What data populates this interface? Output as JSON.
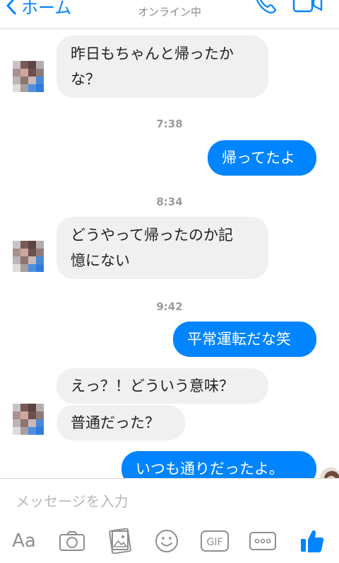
{
  "header": {
    "back_label": "ホーム",
    "status": "オンライン中",
    "icons": [
      "chevron-left-icon",
      "phone-icon",
      "video-camera-icon"
    ]
  },
  "messages": [
    {
      "type": "received",
      "lines": [
        "昨日もちゃんと帰ったか",
        "な？"
      ]
    },
    {
      "type": "time",
      "text": "7:38"
    },
    {
      "type": "sent",
      "text": "帰ってたよ"
    },
    {
      "type": "time",
      "text": "8:34"
    },
    {
      "type": "received",
      "lines": [
        "どうやって帰ったのか記",
        "憶にない"
      ]
    },
    {
      "type": "time",
      "text": "9:42"
    },
    {
      "type": "sent",
      "text": "平常運転だな笑"
    },
    {
      "type": "received",
      "text": "えっ？！どういう意味？"
    },
    {
      "type": "received",
      "text": "普通だった？"
    },
    {
      "type": "sent",
      "text": "いつも通りだったよ。"
    }
  ],
  "composer": {
    "placeholder": "メッセージを入力",
    "aa_label": "Aa",
    "gif_label": "GIF",
    "icons": [
      "text-format-icon",
      "camera-icon",
      "photo-gallery-icon",
      "emoji-icon",
      "gif-icon",
      "more-icon",
      "like-icon"
    ]
  },
  "colors": {
    "accent": "#0084ff",
    "received_bubble": "#f1f0f0",
    "separator": "#d8d8d8"
  }
}
